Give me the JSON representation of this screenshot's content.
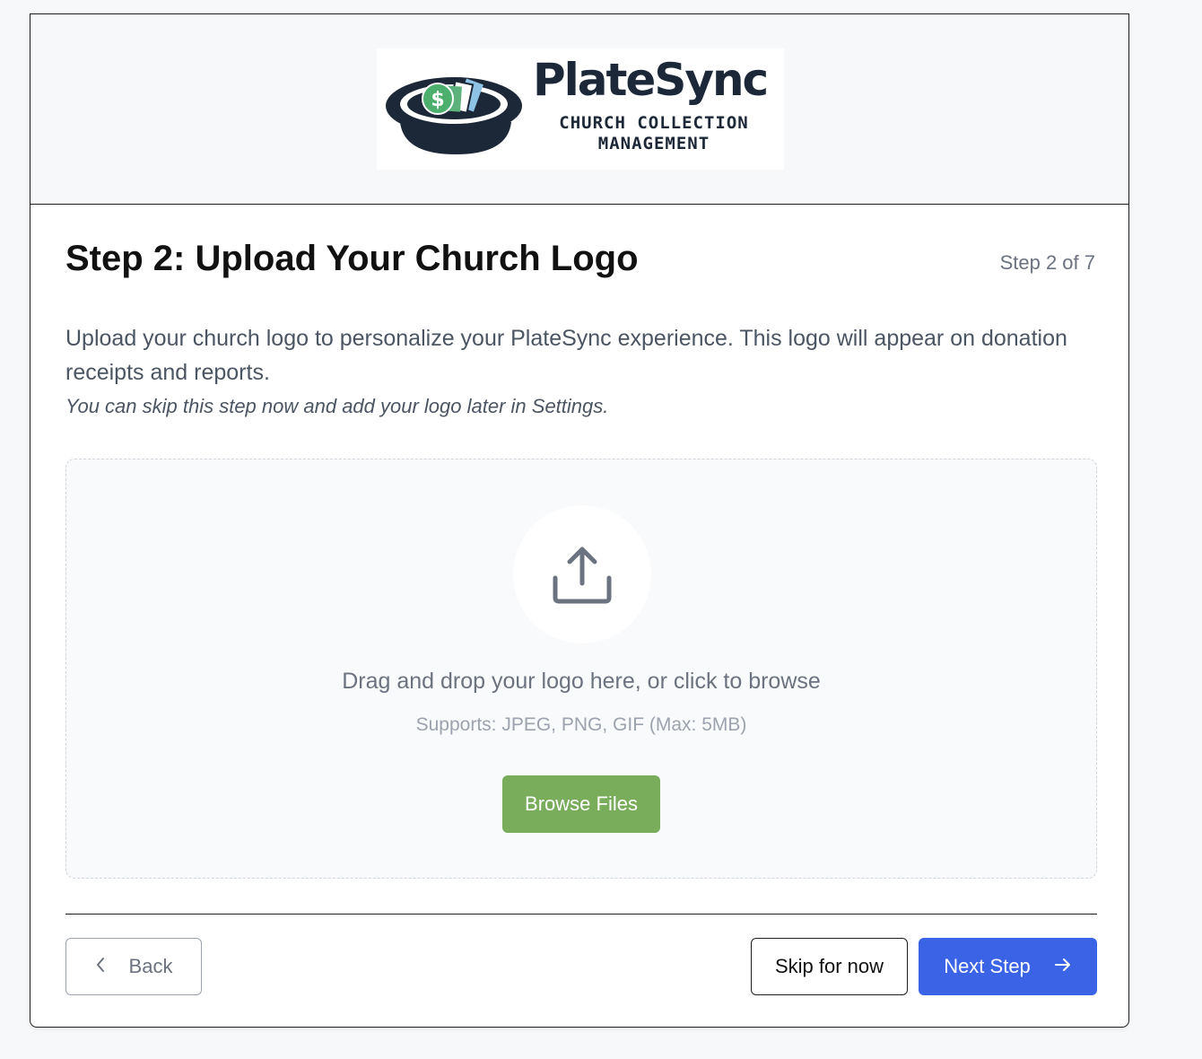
{
  "brand": {
    "name": "PlateSync",
    "tagline_line1": "CHURCH COLLECTION",
    "tagline_line2": "MANAGEMENT",
    "logo_icon": "collection-plate-with-money-icon"
  },
  "page": {
    "title": "Step 2: Upload Your Church Logo",
    "step_indicator": "Step 2 of 7",
    "description": "Upload your church logo to personalize your PlateSync experience. This logo will appear on donation receipts and reports.",
    "note": "You can skip this step now and add your logo later in Settings."
  },
  "dropzone": {
    "icon": "upload-icon",
    "prompt": "Drag and drop your logo here, or click to browse",
    "supports": "Supports: JPEG, PNG, GIF (Max: 5MB)",
    "browse_label": "Browse Files"
  },
  "footer": {
    "back_label": "Back",
    "back_icon": "chevron-left-icon",
    "skip_label": "Skip for now",
    "next_label": "Next Step",
    "next_icon": "arrow-right-icon"
  },
  "colors": {
    "brand_navy": "#1c2838",
    "browse_green": "#79ad5b",
    "next_blue": "#3a63e6",
    "money_green": "#4caf6e"
  }
}
